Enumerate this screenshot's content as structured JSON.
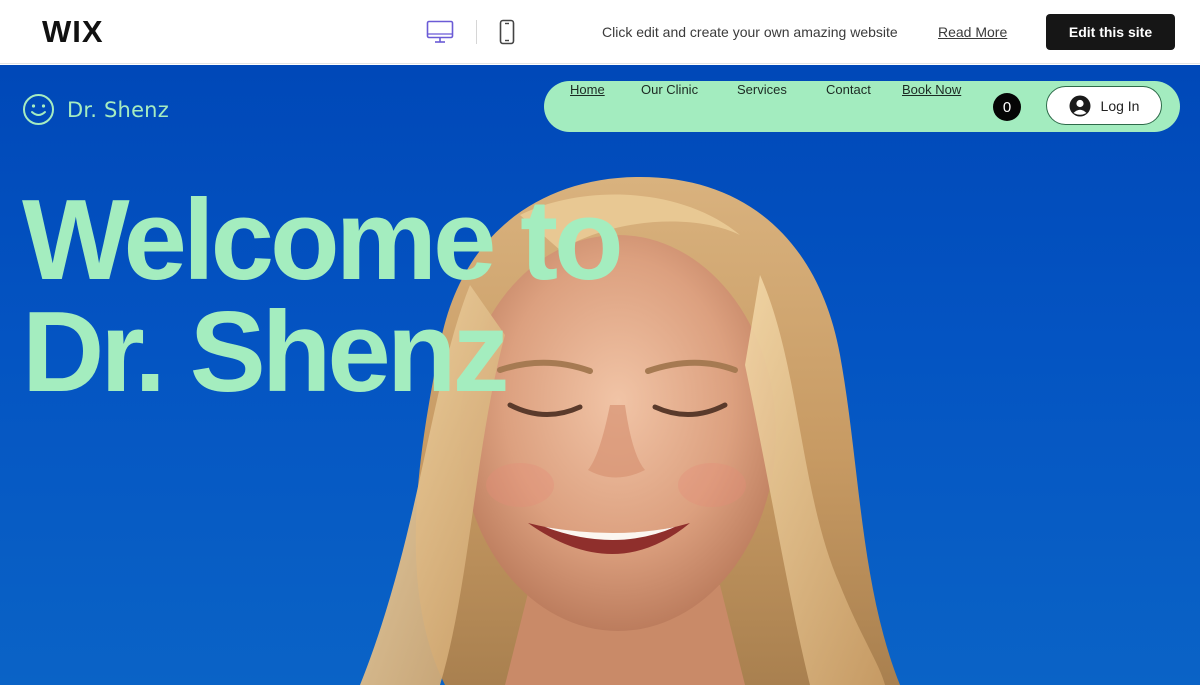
{
  "wix_bar": {
    "logo": "WIX",
    "promo_text": "Click edit and create your own amazing website",
    "read_more": "Read More",
    "edit_button": "Edit this site",
    "device_icons": [
      "desktop-icon",
      "mobile-icon"
    ]
  },
  "site": {
    "brand_name": "Dr. Shenz",
    "brand_icon": "smiley-icon",
    "nav": {
      "items": [
        {
          "label": "Home"
        },
        {
          "label": "Our Clinic"
        },
        {
          "label": "Services"
        },
        {
          "label": "Contact"
        },
        {
          "label": "Book Now"
        }
      ],
      "cart_count": "0",
      "login_label": "Log In",
      "login_icon": "user-avatar-icon"
    },
    "hero": {
      "headline_line1": "Welcome to",
      "headline_line2": "Dr. Shenz"
    }
  },
  "colors": {
    "hero_blue": "#0048b8",
    "accent_mint": "#a3ecbf",
    "edit_button_bg": "#161616"
  }
}
